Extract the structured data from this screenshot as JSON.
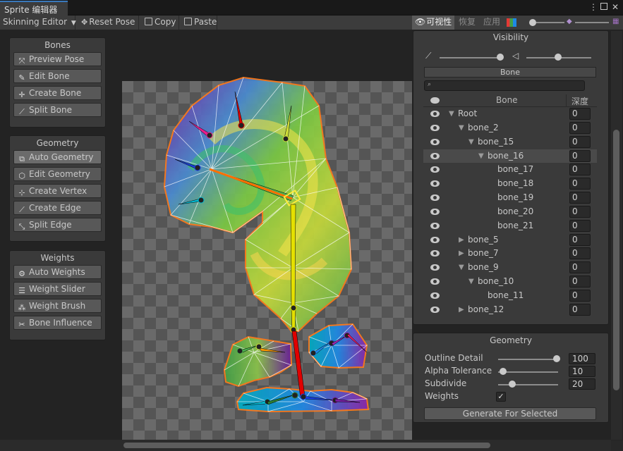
{
  "window": {
    "tab_title": "Sprite 编辑器",
    "more_icon": "kebab-icon",
    "maximize_icon": "maximize-icon",
    "close_icon": "close-icon"
  },
  "toolbar": {
    "mode_label": "Skinning Editor",
    "reset_pose": "Reset Pose",
    "copy": "Copy",
    "paste": "Paste",
    "visibility": "可视性",
    "restore": "恢复",
    "apply": "应用",
    "accent": "#3a79bb"
  },
  "bones_panel": {
    "title": "Bones",
    "buttons": [
      "Preview Pose",
      "Edit Bone",
      "Create Bone",
      "Split Bone"
    ]
  },
  "geometry_panel": {
    "title": "Geometry",
    "buttons": [
      "Auto Geometry",
      "Edit Geometry",
      "Create Vertex",
      "Create Edge",
      "Split Edge"
    ]
  },
  "weights_panel": {
    "title": "Weights",
    "buttons": [
      "Auto Weights",
      "Weight Slider",
      "Weight Brush",
      "Bone Influence"
    ]
  },
  "visibility_panel": {
    "title": "Visibility",
    "tab": "Bone",
    "col_bone": "Bone",
    "col_depth": "深度",
    "rows": [
      {
        "name": "Root",
        "depth": "0",
        "level": 0,
        "expanded": true
      },
      {
        "name": "bone_2",
        "depth": "0",
        "level": 1,
        "expanded": true
      },
      {
        "name": "bone_15",
        "depth": "0",
        "level": 2,
        "expanded": true
      },
      {
        "name": "bone_16",
        "depth": "0",
        "level": 3,
        "expanded": true,
        "selected": true
      },
      {
        "name": "bone_17",
        "depth": "0",
        "level": 4
      },
      {
        "name": "bone_18",
        "depth": "0",
        "level": 4
      },
      {
        "name": "bone_19",
        "depth": "0",
        "level": 4
      },
      {
        "name": "bone_20",
        "depth": "0",
        "level": 4
      },
      {
        "name": "bone_21",
        "depth": "0",
        "level": 4
      },
      {
        "name": "bone_5",
        "depth": "0",
        "level": 1,
        "expanded": false
      },
      {
        "name": "bone_7",
        "depth": "0",
        "level": 1,
        "expanded": false
      },
      {
        "name": "bone_9",
        "depth": "0",
        "level": 1,
        "expanded": true
      },
      {
        "name": "bone_10",
        "depth": "0",
        "level": 2,
        "expanded": true
      },
      {
        "name": "bone_11",
        "depth": "0",
        "level": 3
      },
      {
        "name": "bone_12",
        "depth": "0",
        "level": 1,
        "expanded": false
      }
    ]
  },
  "geometry_settings": {
    "title": "Geometry",
    "outline_detail_label": "Outline Detail",
    "outline_detail_value": "100",
    "alpha_tolerance_label": "Alpha Tolerance",
    "alpha_tolerance_value": "10",
    "subdivide_label": "Subdivide",
    "subdivide_value": "20",
    "weights_label": "Weights",
    "weights_checked": true,
    "generate_button": "Generate For Selected"
  }
}
